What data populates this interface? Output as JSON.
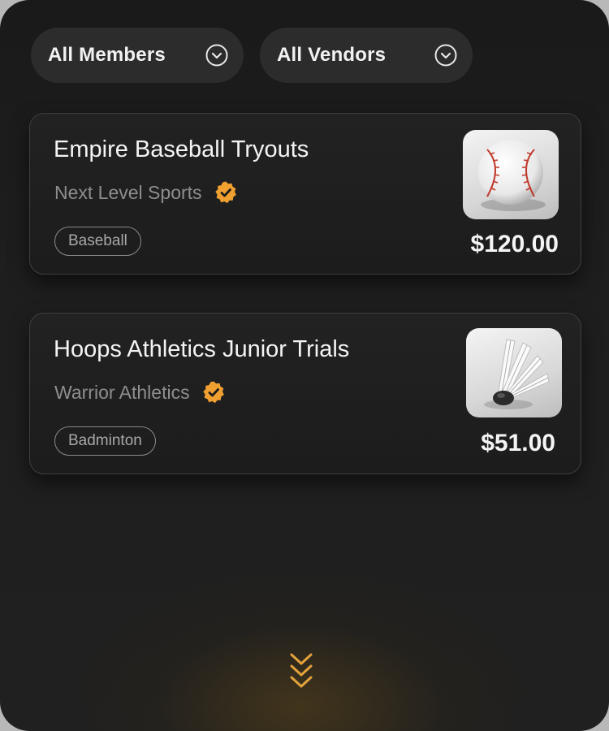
{
  "filters": {
    "members_label": "All Members",
    "vendors_label": "All Vendors"
  },
  "events": [
    {
      "title": "Empire Baseball Tryouts",
      "vendor": "Next Level Sports",
      "verified": true,
      "sport_tag": "Baseball",
      "price": "$120.00",
      "image_icon": "baseball-icon"
    },
    {
      "title": "Hoops Athletics Junior Trials",
      "vendor": "Warrior Athletics",
      "verified": true,
      "sport_tag": "Badminton",
      "price": "$51.00",
      "image_icon": "shuttlecock-icon"
    }
  ],
  "colors": {
    "accent": "#f0a030",
    "background": "#1c1c1c",
    "card_border": "#3f3f3f"
  },
  "icons": {
    "dropdown": "chevron-down-circle-icon",
    "verified": "verified-badge-icon",
    "scroll_more": "double-chevron-down-icon"
  }
}
